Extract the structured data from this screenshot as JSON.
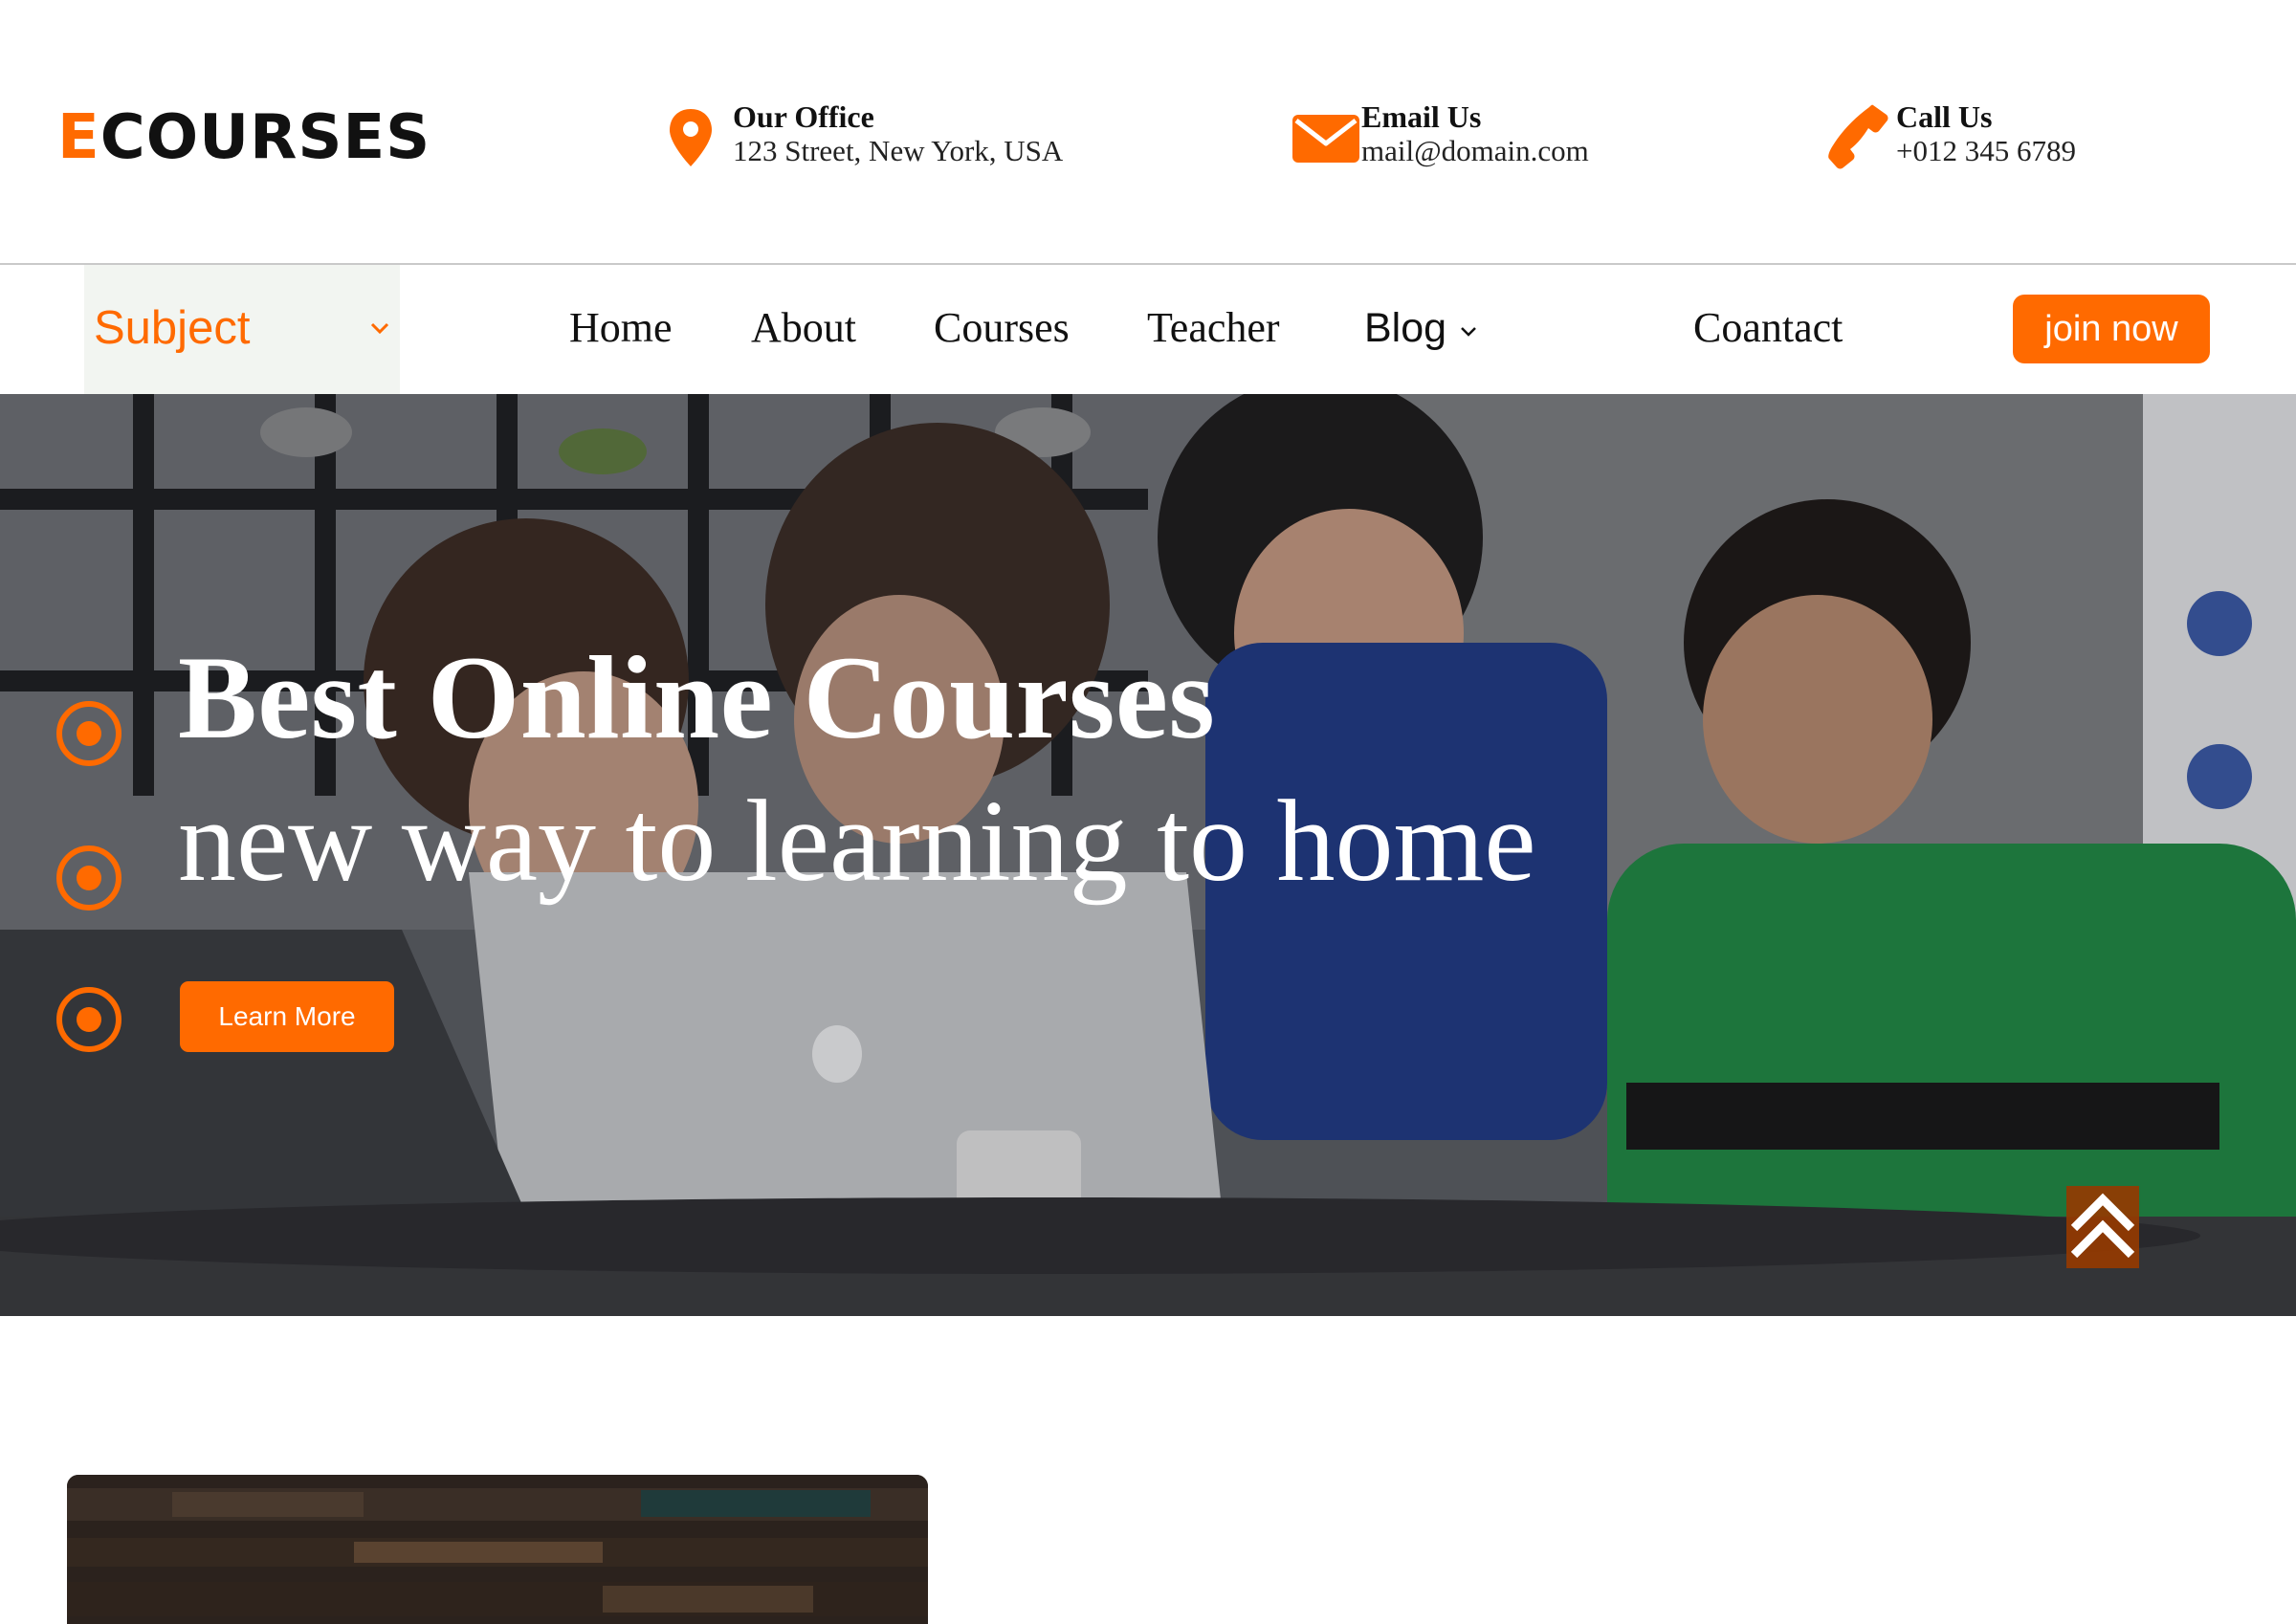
{
  "brand": {
    "first_letter": "E",
    "rest": "COURSES"
  },
  "header": {
    "office": {
      "icon": "map-pin-icon",
      "title": "Our Office",
      "value": "123 Street, New York, USA"
    },
    "email": {
      "icon": "envelope-icon",
      "title": "Email Us",
      "value": "mail@domain.com"
    },
    "call": {
      "icon": "phone-icon",
      "title": "Call Us",
      "value": "+012 345 6789"
    }
  },
  "nav": {
    "subject": "Subject",
    "links": [
      "Home",
      "About",
      "Courses",
      "Teacher",
      "Blog",
      "Coantact"
    ],
    "join": "join now"
  },
  "hero": {
    "title": "Best Online Courses",
    "subtitle": "new way to learning to home",
    "button": "Learn More",
    "carousel_indicators": 3
  },
  "colors": {
    "accent": "#ff6a00",
    "text": "#111111",
    "subject_bg": "#f2f5f1"
  }
}
